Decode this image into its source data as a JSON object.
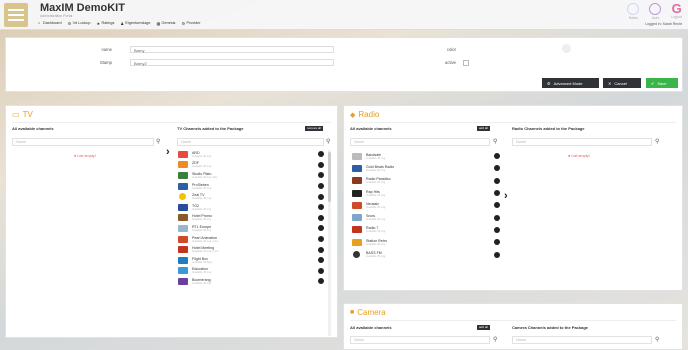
{
  "header": {
    "title": "MaxIM DemoKIT",
    "subtitle": "Administration Portal",
    "nav": [
      {
        "label": "Dashboard",
        "icon": "home-icon"
      },
      {
        "label": "Vd Lockup",
        "icon": "gear-icon"
      },
      {
        "label": "Ratings",
        "icon": "star-icon"
      },
      {
        "label": "Eigentumslage",
        "icon": "user-icon"
      },
      {
        "label": "Genesis",
        "icon": "grid-icon"
      },
      {
        "label": "Provider",
        "icon": "gear-icon"
      }
    ],
    "right": [
      {
        "label": "Notes",
        "icon": "notes-icon"
      },
      {
        "label": "User",
        "icon": "user-circle-icon"
      },
      {
        "label": "Logout",
        "icon": "logout-icon"
      }
    ],
    "logged_in": "Logged in: Sarah Recht"
  },
  "form": {
    "name_label": "name",
    "name_value": "Barny",
    "stamp_label": "Stamp",
    "stamp_value": "Barny2",
    "color_label": "color",
    "active_label": "active",
    "advanced_label": "Advanced Mode",
    "cancel_label": "Cancel",
    "save_label": "Save"
  },
  "tv": {
    "title": "TV",
    "available_title": "All available channels",
    "added_title": "TV Channels added to the Package",
    "remove_all": "remove all",
    "search_placeholder": "Name",
    "empty_text": "List empty!",
    "channels": [
      {
        "name": "ARD",
        "sub": "Available 45 orig.",
        "color": "#e84b3a"
      },
      {
        "name": "ZDF",
        "sub": "Available 45 orig.",
        "color": "#f08a24"
      },
      {
        "name": "Studio Plato",
        "sub": "Available 45 orig. dely",
        "color": "#3a7f3a"
      },
      {
        "name": "ProSieben",
        "sub": "Available 45 orig.",
        "color": "#2d5ea8"
      },
      {
        "name": "Zeal TV",
        "sub": "Available 45 orig.",
        "color": "#f2c200"
      },
      {
        "name": "TG2",
        "sub": "Available 45 orig.",
        "color": "#2b4c9a"
      },
      {
        "name": "Hotel Promo",
        "sub": "Available 45 orig.",
        "color": "#8b5a2b"
      },
      {
        "name": "RTL Europe",
        "sub": "Available 45 orig.",
        "color": "#9bb4d1"
      },
      {
        "name": "Pearl Animation",
        "sub": "Available 45 orig. prom",
        "color": "#d04a2a"
      },
      {
        "name": "Hotel Meeting",
        "sub": "Available 45 orig. prom",
        "color": "#c2341f"
      },
      {
        "name": "Flight Box",
        "sub": "Available 45 flight",
        "color": "#1f7bc2"
      },
      {
        "name": "Education",
        "sub": "Available 45 orig.",
        "color": "#3a9ad9"
      },
      {
        "name": "Boomerang",
        "sub": "Available 45 orig.",
        "color": "#6a3fa0"
      }
    ]
  },
  "radio": {
    "title": "Radio",
    "available_title": "All available channels",
    "added_title": "Radio Channels added to the Package",
    "add_all": "add all",
    "search_placeholder": "Name",
    "empty_text": "List empty!",
    "channels": [
      {
        "name": "Bandsale",
        "sub": "Available 45 orig.",
        "color": "#bbb"
      },
      {
        "name": "Gold Beats Radio",
        "sub": "Available 45 orig.",
        "color": "#2d5ea8"
      },
      {
        "name": "Radio Paradiso",
        "sub": "Available 45 orig.",
        "color": "#8b3a1f"
      },
      {
        "name": "Rap Hits",
        "sub": "Available 45 orig.",
        "color": "#222"
      },
      {
        "name": "Neusalz",
        "sub": "Available 45 orig.",
        "color": "#d04a2a"
      },
      {
        "name": "Snow",
        "sub": "Available 45 orig.",
        "color": "#7fa6c9"
      },
      {
        "name": "Radio 7",
        "sub": "Available 45 orig.",
        "color": "#c2341f"
      },
      {
        "name": "Station Retro",
        "sub": "Available 45 orig.",
        "color": "#e8a020"
      },
      {
        "name": "BASS FM",
        "sub": "Available 45 orig.",
        "color": "#333"
      }
    ]
  },
  "camera": {
    "title": "Camera",
    "available_title": "All available channels",
    "added_title": "Camera Channels added to the Package",
    "add_all": "add all",
    "search_placeholder": "Name"
  },
  "colors": {
    "accent": "#e69f1f",
    "dark": "#2f3338",
    "green": "#3bb54a",
    "danger": "#e05a5a"
  }
}
